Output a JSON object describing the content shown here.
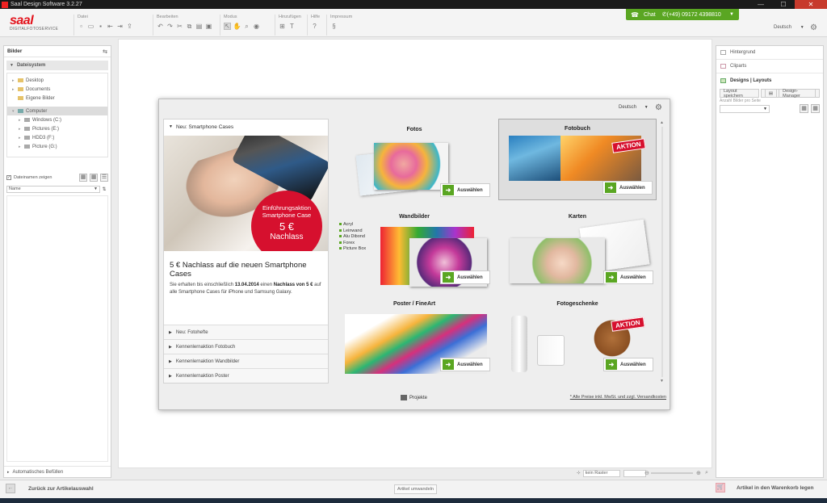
{
  "window": {
    "title": "Saal Design Software 3.2.27",
    "controls": [
      "—",
      "☐",
      "✕"
    ]
  },
  "logo": {
    "brand": "saal",
    "sub": "DIGITALFOTOSERVICE"
  },
  "toolbar": {
    "groups": [
      {
        "label": "Datei"
      },
      {
        "label": "Bearbeiten"
      },
      {
        "label": "Modus"
      },
      {
        "label": "Hinzufügen"
      },
      {
        "label": "Hilfe"
      },
      {
        "label": "Impressum"
      }
    ],
    "chat_label": "Chat",
    "phone": "(+49) 09172 4398810",
    "language": "Deutsch"
  },
  "left_panel": {
    "title": "Bilder",
    "section": "Dateisystem",
    "tree": [
      {
        "label": "Desktop",
        "type": "folder"
      },
      {
        "label": "Documents",
        "type": "folder"
      },
      {
        "label": "Eigene Bilder",
        "type": "folder"
      },
      {
        "label": "Computer",
        "type": "computer"
      },
      {
        "label": "Windows (C:)",
        "type": "drive"
      },
      {
        "label": "Pictures (E:)",
        "type": "drive"
      },
      {
        "label": "HDD3 (F:)",
        "type": "drive"
      },
      {
        "label": "Picture (G:)",
        "type": "drive"
      }
    ],
    "show_names_label": "Dateinamen zeigen",
    "sort_label": "Name",
    "footer": "Automatisches Befüllen"
  },
  "right_panel": {
    "items": [
      "Hintergrund",
      "Cliparts",
      "Designs | Layouts"
    ],
    "save_layout": "Layout speichern",
    "design_manager": "Design-Manager",
    "count_label": "Anzahl Bilder pro Seite"
  },
  "workspace": {
    "raster_label": "kein Raster"
  },
  "dialog": {
    "language": "Deutsch",
    "promo": {
      "header": "Neu: Smartphone Cases",
      "badge_line1": "Einführungsaktion",
      "badge_line2": "Smartphone Case",
      "badge_price": "5 €",
      "badge_line3": "Nachlass",
      "headline": "5 € Nachlass auf die neuen Smartphone Cases",
      "text_1": "Sie erhalten bis einschließlich ",
      "text_date": "13.04.2014",
      "text_2": " einen ",
      "text_bold": "Nachlass von 5 €",
      "text_3": " auf alle Smartphone Cases für iPhone und Samsung Galaxy.",
      "accordion": [
        "Neu: Fotohefte",
        "Kennenlernaktion Fotobuch",
        "Kennenlernaktion Wandbilder",
        "Kennenlernaktion Poster"
      ]
    },
    "products": [
      {
        "title": "Fotos",
        "button": "Auswählen"
      },
      {
        "title": "Fotobuch",
        "button": "Auswählen",
        "badge": "AKTION"
      },
      {
        "title": "Wandbilder",
        "button": "Auswählen",
        "features": [
          "Acryl",
          "Leinwand",
          "Alu Dibond",
          "Forex",
          "Picture Box"
        ]
      },
      {
        "title": "Karten",
        "button": "Auswählen"
      },
      {
        "title": "Poster / FineArt",
        "button": "Auswählen"
      },
      {
        "title": "Fotogeschenke",
        "button": "Auswählen",
        "badge": "AKTION"
      }
    ],
    "projects_label": "Projekte",
    "prices_note": "* Alle Preise inkl. MwSt. und zzgl. Versandkosten"
  },
  "bottom_bar": {
    "back": "Zurück zur Artikelauswahl",
    "convert": "Artikel umwandeln",
    "cart": "Artikel in den Warenkorb legen"
  },
  "colors": {
    "accent_green": "#5aa622",
    "brand_red": "#e3121b",
    "badge_red": "#d6102e"
  }
}
